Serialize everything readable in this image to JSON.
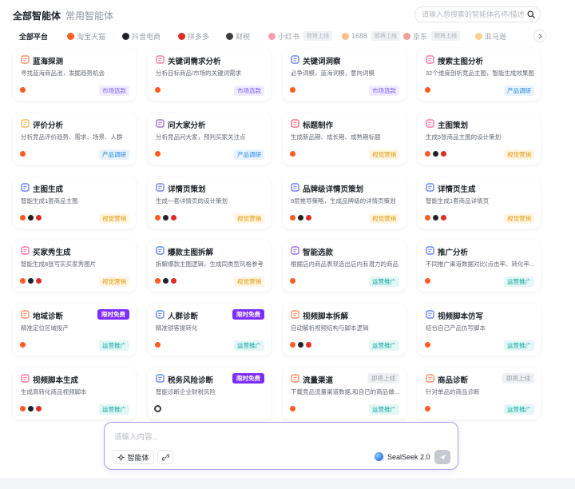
{
  "header": {
    "tab_all": "全部智能体",
    "tab_common": "常用智能体",
    "search_placeholder": "请输入想搜索的智能体名称/描述"
  },
  "colors": {
    "taobao": "#ff5a1f",
    "douyin": "#1f2329",
    "pdd": "#e02e24",
    "finance": "#3d3d3d",
    "xhs": "#ff2442",
    "1688": "#ff6a00",
    "jd": "#e1251b",
    "amazon": "#ff9900",
    "free_badge": "#7d2dff",
    "market": "#7b5cff",
    "product": "#1e88e5",
    "visual": "#e69500",
    "ops": "#0aa5a0"
  },
  "platforms": [
    {
      "label": "全部平台",
      "icon": "",
      "soon": ""
    },
    {
      "label": "淘宝天猫",
      "icon": "taobao-icon",
      "soon": ""
    },
    {
      "label": "抖音电商",
      "icon": "douyin-icon",
      "soon": ""
    },
    {
      "label": "拼多多",
      "icon": "pdd-icon",
      "soon": ""
    },
    {
      "label": "财税",
      "icon": "finance-icon",
      "soon": ""
    },
    {
      "label": "小红书",
      "icon": "xhs-icon",
      "soon": "即将上线"
    },
    {
      "label": "1688",
      "icon": "1688-icon",
      "soon": "即将上线"
    },
    {
      "label": "京东",
      "icon": "jd-icon",
      "soon": "即将上线"
    },
    {
      "label": "亚马逊",
      "icon": "amazon-icon",
      "soon": ""
    }
  ],
  "cards": [
    {
      "title": "蓝海探测",
      "desc": "寻找蓝海商品池，发掘趋势机会",
      "cat": "市场选款",
      "badge": "",
      "plats": [
        "taobao"
      ],
      "icon": "chart-icon",
      "icolor": "#ff7a45"
    },
    {
      "title": "关键词需求分析",
      "desc": "分析目标商品/市场的关键词需求",
      "cat": "市场选款",
      "badge": "",
      "plats": [
        "taobao"
      ],
      "icon": "doc-icon",
      "icolor": "#ff5b8a"
    },
    {
      "title": "关键词洞察",
      "desc": "必争词模，蓝海词模，意向词模",
      "cat": "市场选款",
      "badge": "",
      "plats": [
        "taobao"
      ],
      "icon": "bulb-icon",
      "icolor": "#4c6fff"
    },
    {
      "title": "搜索主图分析",
      "desc": "32个维度剖析竞品主图，智能生成效果图",
      "cat": "产品调研",
      "badge": "",
      "plats": [
        "taobao"
      ],
      "icon": "search-doc-icon",
      "icolor": "#ff5b8a"
    },
    {
      "title": "评价分析",
      "desc": "分析竞品评价趋势、需求、场景、人群",
      "cat": "产品调研",
      "badge": "",
      "plats": [
        "taobao"
      ],
      "icon": "comment-icon",
      "icolor": "#ffa940"
    },
    {
      "title": "问大家分析",
      "desc": "分析竞品问大家，预判买家关注点",
      "cat": "产品调研",
      "badge": "",
      "plats": [
        "taobao"
      ],
      "icon": "question-icon",
      "icolor": "#9254de"
    },
    {
      "title": "标题制作",
      "desc": "生成新品期、成长期、成熟期标题",
      "cat": "视觉营销",
      "badge": "",
      "plats": [
        "taobao"
      ],
      "icon": "tag-icon",
      "icolor": "#ff4d6a"
    },
    {
      "title": "主图策划",
      "desc": "生成5张商品主图的设计策划",
      "cat": "视觉营销",
      "badge": "",
      "plats": [
        "taobao",
        "douyin",
        "pdd"
      ],
      "icon": "image-icon",
      "icolor": "#ff5b8a"
    },
    {
      "title": "主图生成",
      "desc": "智能生成1套商品主图",
      "cat": "视觉营销",
      "badge": "",
      "plats": [
        "taobao",
        "douyin",
        "pdd"
      ],
      "icon": "image-gen-icon",
      "icolor": "#4c6fff"
    },
    {
      "title": "详情页策划",
      "desc": "生成一套详情页的设计策划",
      "cat": "视觉营销",
      "badge": "",
      "plats": [
        "taobao",
        "douyin",
        "pdd"
      ],
      "icon": "layout-icon",
      "icolor": "#4c6fff"
    },
    {
      "title": "品牌级详情页策划",
      "desc": "8层推导策略，生成品牌级的详情页策划",
      "cat": "视觉营销",
      "badge": "",
      "plats": [
        "taobao",
        "douyin",
        "pdd"
      ],
      "icon": "crown-icon",
      "icolor": "#4c6fff"
    },
    {
      "title": "详情页生成",
      "desc": "智能生成1套商品详情页",
      "cat": "视觉营销",
      "badge": "",
      "plats": [
        "taobao",
        "douyin",
        "pdd"
      ],
      "icon": "page-icon",
      "icolor": "#4c6fff"
    },
    {
      "title": "买家秀生成",
      "desc": "智能生成8张写实买家秀图片",
      "cat": "视觉营销",
      "badge": "",
      "plats": [
        "taobao",
        "douyin",
        "pdd"
      ],
      "icon": "photo-icon",
      "icolor": "#ff5b8a"
    },
    {
      "title": "爆款主图拆解",
      "desc": "拆解爆款主图逻辑，生成同类型风格参考",
      "cat": "视觉营销",
      "badge": "",
      "plats": [
        "taobao",
        "douyin",
        "pdd"
      ],
      "icon": "split-image-icon",
      "icolor": "#4c6fff"
    },
    {
      "title": "智能选款",
      "desc": "根据店内商品表现选出店内有潜力的商品",
      "cat": "运营推广",
      "badge": "",
      "plats": [
        "taobao"
      ],
      "icon": "pin-icon",
      "icolor": "#9254de"
    },
    {
      "title": "推广分析",
      "desc": "不同推广渠道数据对比(点击率、转化率...",
      "cat": "运营推广",
      "badge": "",
      "plats": [
        "taobao"
      ],
      "icon": "send-icon",
      "icolor": "#4c6fff"
    },
    {
      "title": "地域诊断",
      "desc": "精准定位区域投产",
      "cat": "运营推广",
      "badge": "限时免费",
      "plats": [
        "taobao"
      ],
      "icon": "location-icon",
      "icolor": "#ff7a45"
    },
    {
      "title": "人群诊断",
      "desc": "精准锁客提转化",
      "cat": "运营推广",
      "badge": "限时免费",
      "plats": [
        "taobao"
      ],
      "icon": "users-icon",
      "icolor": "#4c6fff"
    },
    {
      "title": "视频脚本拆解",
      "desc": "自动解析视频结构与脚本逻辑",
      "cat": "运营推广",
      "badge": "",
      "plats": [
        "taobao",
        "douyin",
        "pdd"
      ],
      "icon": "video-split-icon",
      "icolor": "#ff7a45"
    },
    {
      "title": "视频脚本仿写",
      "desc": "结合自己产品仿写脚本",
      "cat": "运营推广",
      "badge": "",
      "plats": [
        "taobao"
      ],
      "icon": "video-write-icon",
      "icolor": "#4c6fff"
    },
    {
      "title": "视频脚本生成",
      "desc": "生成高转化商品视频脚本",
      "cat": "运营推广",
      "badge": "",
      "plats": [
        "taobao",
        "douyin",
        "pdd"
      ],
      "icon": "video-gen-icon",
      "icolor": "#ff5b8a"
    },
    {
      "title": "税务风险诊断",
      "desc": "智能诊断企业财税风险",
      "cat": "",
      "badge": "限时免费",
      "plats": [
        "finance"
      ],
      "icon": "shield-icon",
      "icolor": "#4c6fff"
    },
    {
      "title": "流量渠道",
      "desc": "下载竞品流量渠道数据,和自己的商品做...",
      "cat": "运营推广",
      "badge": "即将上线",
      "plats": [
        "taobao"
      ],
      "icon": "pulse-icon",
      "icolor": "#ff7a45"
    },
    {
      "title": "商品诊断",
      "desc": "针对单品的商品诊断",
      "cat": "运营推广",
      "badge": "即将上线",
      "plats": [
        "taobao"
      ],
      "icon": "diagnose-icon",
      "icolor": "#ff7a45"
    }
  ],
  "chat": {
    "placeholder": "请输入内容...",
    "agent_button": "智能体",
    "model_name": "SealSeek 2.0"
  }
}
